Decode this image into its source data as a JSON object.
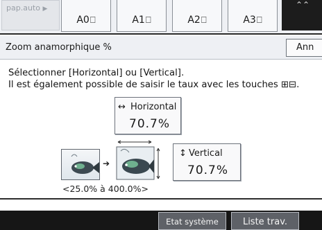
{
  "paper": {
    "auto_label": "pap.auto",
    "sizes": [
      "A0",
      "A1",
      "A2",
      "A3"
    ]
  },
  "zoom": {
    "title": "Zoom anamorphique %",
    "cancel_label": "Ann"
  },
  "instructions": {
    "line1": "Sélectionner [Horizontal] ou [Vertical].",
    "line2": "Il est également possible de saisir le taux avec les touches ⊞⊟."
  },
  "horizontal": {
    "arrow": "↔",
    "label": "Horizontal",
    "value": "70.7%"
  },
  "vertical": {
    "arrow": "↕",
    "label": "Vertical",
    "value": "70.7%"
  },
  "range": "<25.0% à 400.0%>",
  "footer": {
    "system_status": "Etat système",
    "job_list": "Liste trav."
  }
}
